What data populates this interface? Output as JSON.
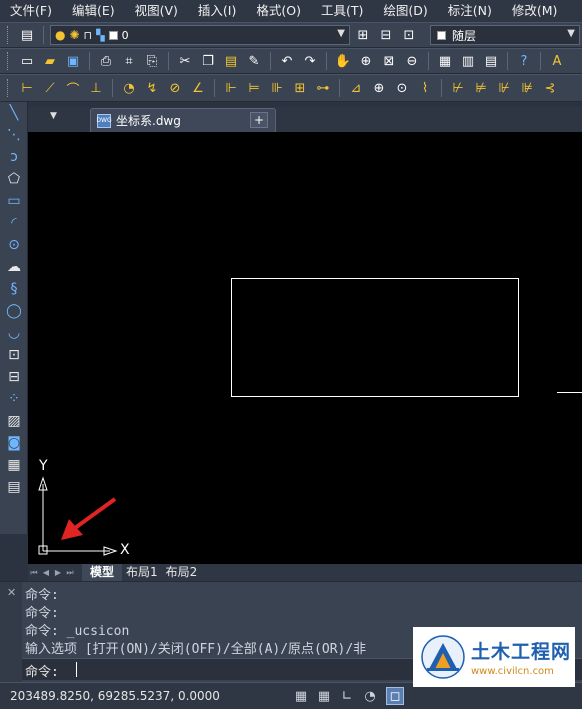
{
  "menubar": {
    "items": [
      "文件(F)",
      "编辑(E)",
      "视图(V)",
      "插入(I)",
      "格式(O)",
      "工具(T)",
      "绘图(D)",
      "标注(N)",
      "修改(M)"
    ]
  },
  "layer_toolbar": {
    "current_layer": "0",
    "color_value": "随层"
  },
  "document_tab": {
    "name": "坐标系.dwg",
    "icon_text": "DWG"
  },
  "canvas": {
    "background": "#000000",
    "line_color": "#ffffff",
    "arrow_color": "#e02424",
    "ucs_x_label": "X",
    "ucs_y_label": "Y"
  },
  "layout_tabs": [
    "模型",
    "布局1",
    "布局2"
  ],
  "command_history": [
    "命令:",
    "命令:",
    "命令: _ucsicon",
    "输入选项 [打开(ON)/关闭(OFF)/全部(A)/原点(OR)/非"
  ],
  "command_prompt": "命令:",
  "status": {
    "coordinates": "203489.8250, 69285.5237, 0.0000"
  },
  "watermark": {
    "title": "土木工程网",
    "url": "www.civilcn.com"
  }
}
